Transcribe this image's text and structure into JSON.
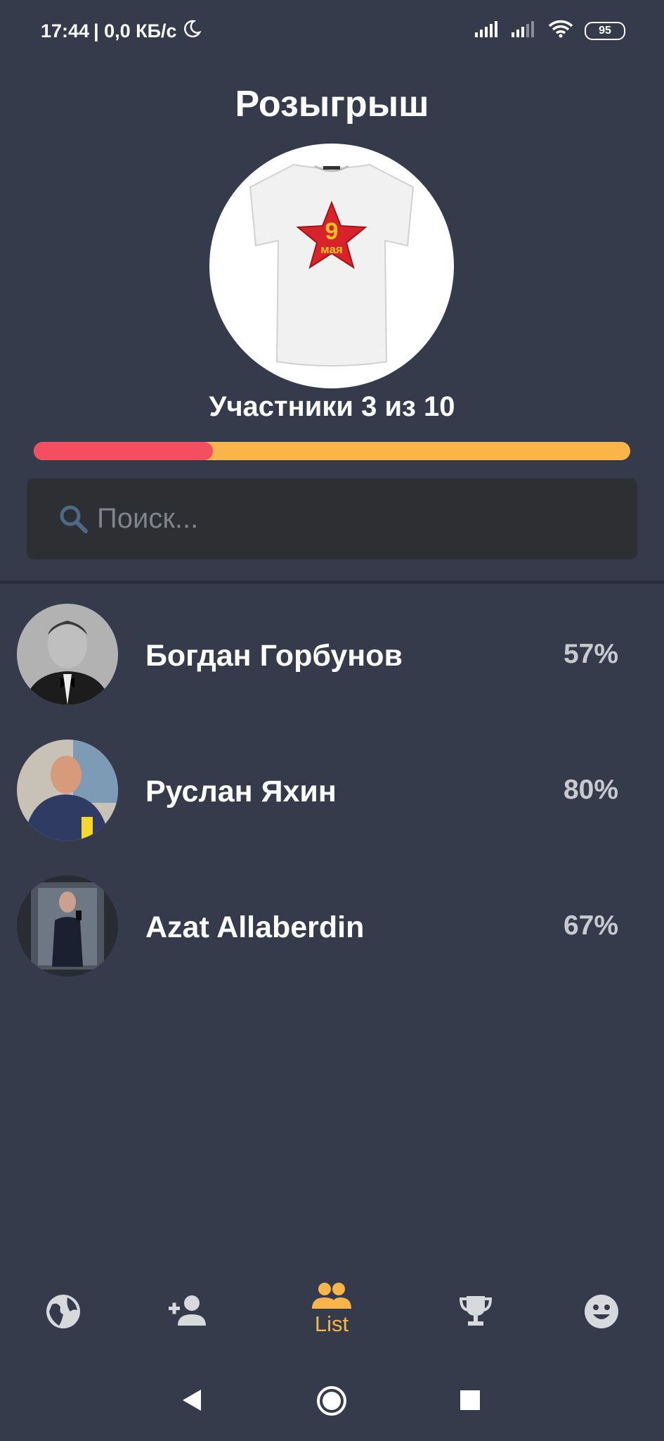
{
  "status_bar": {
    "time": "17:44",
    "network_speed": "| 0,0 КБ/с",
    "battery": "95"
  },
  "header": {
    "title": "Розыгрыш"
  },
  "prize": {
    "image_icon": "tshirt-9-maya-image",
    "star_text_top": "9",
    "star_text_bottom": "мая"
  },
  "participants": {
    "label": "Участники 3 из 10",
    "current": 3,
    "total": 10
  },
  "search": {
    "placeholder": "Поиск...",
    "value": ""
  },
  "list": [
    {
      "name": "Богдан Горбунов",
      "percent": "57%"
    },
    {
      "name": "Руслан Яхин",
      "percent": "80%"
    },
    {
      "name": "Azat Allaberdin",
      "percent": "67%"
    }
  ],
  "bottom_nav": {
    "items": [
      {
        "icon": "globe-icon",
        "label": ""
      },
      {
        "icon": "add-person-icon",
        "label": ""
      },
      {
        "icon": "people-icon",
        "label": "List",
        "active": true
      },
      {
        "icon": "trophy-icon",
        "label": ""
      },
      {
        "icon": "smiley-icon",
        "label": ""
      }
    ]
  },
  "colors": {
    "background": "#353b4b",
    "accent": "#f7b54a",
    "progress_fill": "#f64e61",
    "search_bg": "#2e2f33"
  }
}
